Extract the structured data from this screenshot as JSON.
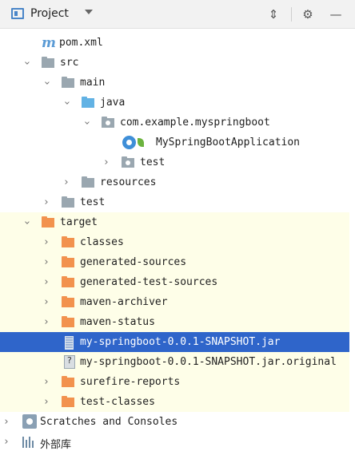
{
  "header": {
    "title": "Project",
    "expand_icon": "collapse-all-icon",
    "settings_icon": "gear-icon",
    "hide_icon": "minimize-icon"
  },
  "tree": {
    "rows": [
      {
        "label": "pom.xml"
      },
      {
        "label": "src"
      },
      {
        "label": "main"
      },
      {
        "label": "java"
      },
      {
        "label": "com.example.myspringboot"
      },
      {
        "label": "MySpringBootApplication"
      },
      {
        "label": "test"
      },
      {
        "label": "resources"
      },
      {
        "label": "test"
      },
      {
        "label": "target"
      },
      {
        "label": "classes"
      },
      {
        "label": "generated-sources"
      },
      {
        "label": "generated-test-sources"
      },
      {
        "label": "maven-archiver"
      },
      {
        "label": "maven-status"
      },
      {
        "label": "my-springboot-0.0.1-SNAPSHOT.jar"
      },
      {
        "label": "my-springboot-0.0.1-SNAPSHOT.jar.original"
      },
      {
        "label": "surefire-reports"
      },
      {
        "label": "test-classes"
      },
      {
        "label": "Scratches and Consoles"
      },
      {
        "label": "外部库"
      }
    ]
  },
  "colors": {
    "selection": "#2f65ca",
    "excluded_band": "#fefee8",
    "folder": "#9aa7b0",
    "source_folder": "#62b2e4",
    "target_folder": "#f2924e"
  }
}
